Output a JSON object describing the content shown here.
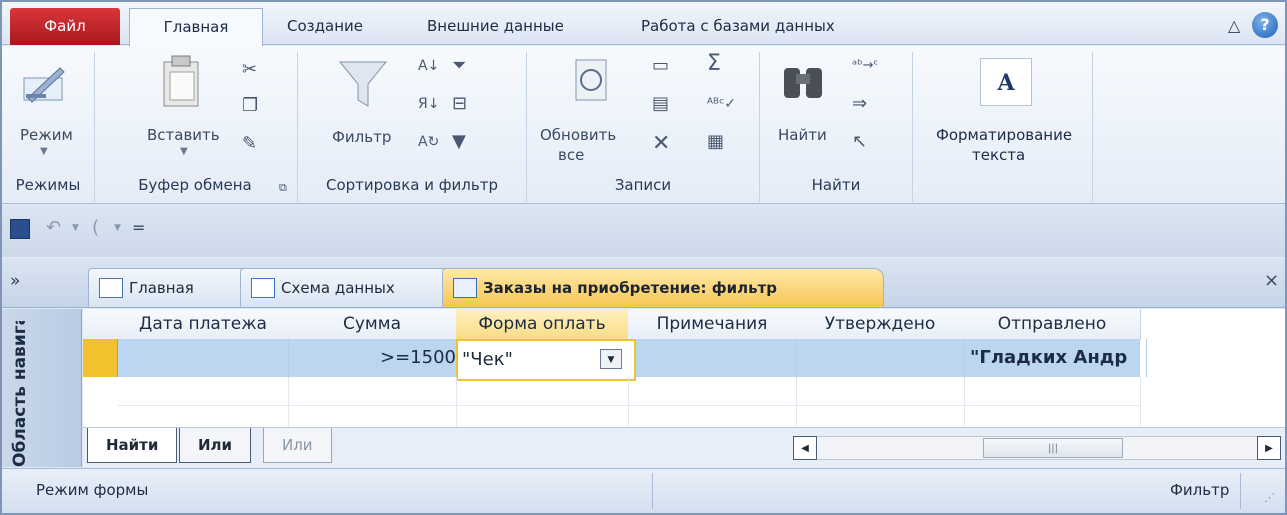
{
  "menu": {
    "file": "Файл",
    "home": "Главная",
    "create": "Создание",
    "external": "Внешние данные",
    "dbtools": "Работа с базами данных",
    "help": "?"
  },
  "ribbon": {
    "views": {
      "mode_label": "Режим",
      "group_label": "Режимы"
    },
    "clipboard": {
      "paste_label": "Вставить",
      "group_label": "Буфер обмена"
    },
    "sort_filter": {
      "filter_label": "Фильтр",
      "group_label": "Сортировка и фильтр"
    },
    "records": {
      "refresh_label_1": "Обновить",
      "refresh_label_2": "все",
      "sum_symbol": "Σ",
      "group_label": "Записи"
    },
    "find": {
      "find_label": "Найти",
      "group_label": "Найти"
    },
    "text_format": {
      "label_1": "Форматирование",
      "label_2": "текста",
      "icon_letter": "A"
    }
  },
  "qat": {
    "redo_symbol": "(",
    "customize_symbol": "="
  },
  "doc_tabs": {
    "nav_toggle": "»",
    "tabs": [
      {
        "label": "Главная"
      },
      {
        "label": "Схема данных"
      },
      {
        "label": "Заказы на приобретение: фильтр"
      }
    ],
    "close": "×"
  },
  "nav_pane": {
    "label": "Область навигации"
  },
  "grid": {
    "columns": [
      "Дата платежа",
      "Сумма",
      "Форма оплать",
      "Примечания",
      "Утверждено",
      "Отправлено"
    ],
    "row": {
      "date": "",
      "amount": ">=1500",
      "payment": "\"Чек\"",
      "notes": "",
      "approved": "",
      "shipped": "\"Гладких Андр"
    }
  },
  "filter_tabs": [
    "Найти",
    "Или",
    "Или"
  ],
  "scrollbar": {
    "thumb_grip": "|||"
  },
  "status": {
    "left": "Режим формы",
    "right": "Фильтр"
  },
  "colors": {
    "file_tab": "#c0282c",
    "active_tab": "#f6c653",
    "selected_row": "#bcd6f2",
    "active_cell_border": "#f2c12e"
  }
}
